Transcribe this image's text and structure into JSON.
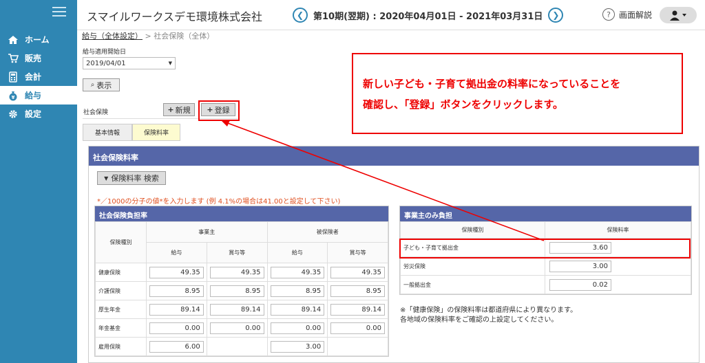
{
  "header": {
    "company": "スマイルワークスデモ環境株式会社",
    "period": "第10期(翌期) : 2020年04月01日 - 2021年03月31日",
    "help_label": "画面解説"
  },
  "sidebar": {
    "items": [
      {
        "label": "ホーム",
        "icon": "home-icon"
      },
      {
        "label": "販売",
        "icon": "cart-icon"
      },
      {
        "label": "会計",
        "icon": "calculator-icon"
      },
      {
        "label": "給与",
        "icon": "moneybag-icon",
        "active": true
      },
      {
        "label": "設定",
        "icon": "gear-icon"
      }
    ]
  },
  "breadcrumb": {
    "link": "給与（全体設定）",
    "sep": ">",
    "current": "社会保険（全体）"
  },
  "form": {
    "start_label": "給与適用開始日",
    "start_date": "2019/04/01",
    "show_button": "表示",
    "insurance_label": "社会保険",
    "new_button": "新規",
    "register_button": "登録"
  },
  "tabs": [
    "基本情報",
    "保険料率"
  ],
  "panel": {
    "title": "社会保険料率",
    "search_button": "保険料率 検索",
    "note": "*／1000の分子の値*を入力します (例 4.1%の場合は41.00と設定して下さい)"
  },
  "burden_table": {
    "title": "社会保険負担率",
    "col_type": "保険種別",
    "employer": "事業主",
    "insured": "被保険者",
    "salary": "給与",
    "bonus": "賞与等",
    "rows": [
      {
        "label": "健康保険",
        "values": [
          "49.35",
          "49.35",
          "49.35",
          "49.35"
        ]
      },
      {
        "label": "介護保険",
        "values": [
          "8.95",
          "8.95",
          "8.95",
          "8.95"
        ]
      },
      {
        "label": "厚生年金",
        "values": [
          "89.14",
          "89.14",
          "89.14",
          "89.14"
        ]
      },
      {
        "label": "年金基金",
        "values": [
          "0.00",
          "0.00",
          "0.00",
          "0.00"
        ]
      },
      {
        "label": "雇用保険",
        "values": [
          "6.00",
          "",
          "3.00",
          ""
        ]
      }
    ]
  },
  "employer_table": {
    "title": "事業主のみ負担",
    "col_type": "保険種別",
    "col_rate": "保険料率",
    "rows": [
      {
        "label": "子ども・子育て拠出金",
        "value": "3.60"
      },
      {
        "label": "労災保険",
        "value": "3.00"
      },
      {
        "label": "一般拠出金",
        "value": "0.02"
      }
    ]
  },
  "footnote": [
    "※「健康保険」の保険料率は都道府県により異なります。",
    "各地域の保険料率をご確認の上設定してください。"
  ],
  "callout": [
    "新しい子ども・子育て拠出金の料率になっていることを",
    "確認し、「登録」ボタンをクリックします。"
  ],
  "colors": {
    "sidebar": "#2f86b3",
    "table_header": "#5566a8",
    "highlight": "#e00000",
    "tab_active": "#fdfbd0"
  }
}
